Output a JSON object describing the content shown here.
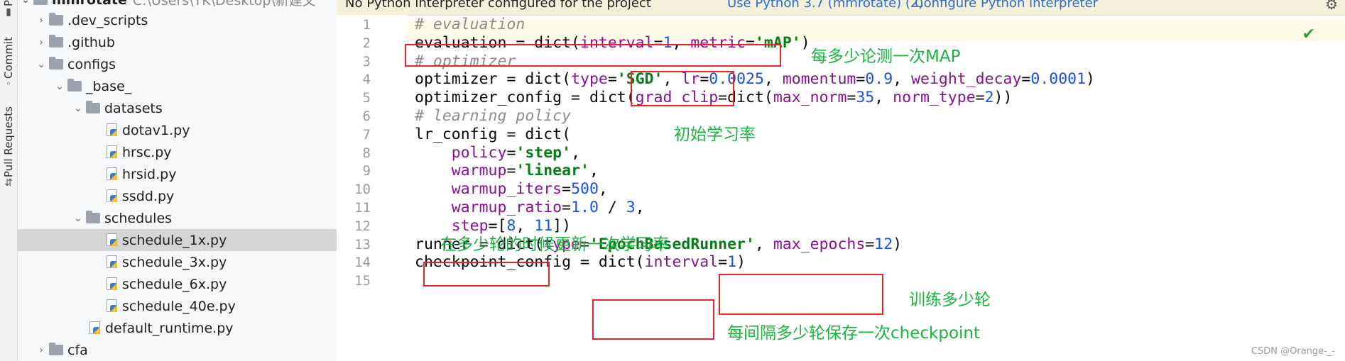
{
  "side_tabs": {
    "project_partial": "P",
    "commit": "Commit",
    "pull_requests": "Pull Requests"
  },
  "project_tree": {
    "root_label": "mmrotate",
    "root_path": "C:\\Users\\YK\\Desktop\\新建文",
    "items": [
      {
        "label": ".dev_scripts",
        "kind": "folder",
        "expanded": false
      },
      {
        "label": ".github",
        "kind": "folder",
        "expanded": false
      },
      {
        "label": "configs",
        "kind": "folder",
        "expanded": true
      },
      {
        "label": "_base_",
        "kind": "folder",
        "expanded": true
      },
      {
        "label": "datasets",
        "kind": "folder",
        "expanded": true
      },
      {
        "label": "dotav1.py",
        "kind": "file"
      },
      {
        "label": "hrsc.py",
        "kind": "file"
      },
      {
        "label": "hrsid.py",
        "kind": "file"
      },
      {
        "label": "ssdd.py",
        "kind": "file"
      },
      {
        "label": "schedules",
        "kind": "folder",
        "expanded": true
      },
      {
        "label": "schedule_1x.py",
        "kind": "file",
        "selected": true
      },
      {
        "label": "schedule_3x.py",
        "kind": "file"
      },
      {
        "label": "schedule_6x.py",
        "kind": "file"
      },
      {
        "label": "schedule_40e.py",
        "kind": "file"
      },
      {
        "label": "default_runtime.py",
        "kind": "file"
      },
      {
        "label": "cfa",
        "kind": "folder",
        "expanded": false
      }
    ]
  },
  "banner": {
    "message": "No Python interpreter configured for the project",
    "use_python_link": "Use Python 3.7 (mmrotate) (2)",
    "configure_link": "Configure Python interpreter"
  },
  "editor": {
    "line_numbers": [
      "1",
      "2",
      "3",
      "4",
      "5",
      "6",
      "7",
      "8",
      "9",
      "10",
      "11",
      "12",
      "13",
      "14",
      "15"
    ],
    "lines": [
      [
        {
          "t": "cm",
          "v": "# evaluation"
        }
      ],
      [
        {
          "t": "",
          "v": "evaluation = dict("
        },
        {
          "t": "kw",
          "v": "interval"
        },
        {
          "t": "",
          "v": "="
        },
        {
          "t": "num",
          "v": "1"
        },
        {
          "t": "",
          "v": ", "
        },
        {
          "t": "kw",
          "v": "metric"
        },
        {
          "t": "",
          "v": "="
        },
        {
          "t": "str",
          "v": "'mAP'"
        },
        {
          "t": "",
          "v": ")"
        }
      ],
      [
        {
          "t": "cm",
          "v": "# optimizer"
        }
      ],
      [
        {
          "t": "",
          "v": "optimizer = dict("
        },
        {
          "t": "kw",
          "v": "type"
        },
        {
          "t": "",
          "v": "="
        },
        {
          "t": "str",
          "v": "'SGD'"
        },
        {
          "t": "",
          "v": ", "
        },
        {
          "t": "kw",
          "v": "lr"
        },
        {
          "t": "",
          "v": "="
        },
        {
          "t": "num",
          "v": "0.0025"
        },
        {
          "t": "",
          "v": ", "
        },
        {
          "t": "kw",
          "v": "momentum"
        },
        {
          "t": "",
          "v": "="
        },
        {
          "t": "num",
          "v": "0.9"
        },
        {
          "t": "",
          "v": ", "
        },
        {
          "t": "kw",
          "v": "weight_decay"
        },
        {
          "t": "",
          "v": "="
        },
        {
          "t": "num",
          "v": "0.0001"
        },
        {
          "t": "",
          "v": ")"
        }
      ],
      [
        {
          "t": "",
          "v": "optimizer_config = dict("
        },
        {
          "t": "kw",
          "v": "grad_clip"
        },
        {
          "t": "",
          "v": "=dict("
        },
        {
          "t": "kw",
          "v": "max_norm"
        },
        {
          "t": "",
          "v": "="
        },
        {
          "t": "num",
          "v": "35"
        },
        {
          "t": "",
          "v": ", "
        },
        {
          "t": "kw",
          "v": "norm_type"
        },
        {
          "t": "",
          "v": "="
        },
        {
          "t": "num",
          "v": "2"
        },
        {
          "t": "",
          "v": "))"
        }
      ],
      [
        {
          "t": "cm",
          "v": "# learning policy"
        }
      ],
      [
        {
          "t": "",
          "v": "lr_config = dict("
        }
      ],
      [
        {
          "t": "",
          "v": "    "
        },
        {
          "t": "kw",
          "v": "policy"
        },
        {
          "t": "",
          "v": "="
        },
        {
          "t": "str",
          "v": "'step'"
        },
        {
          "t": "",
          "v": ","
        }
      ],
      [
        {
          "t": "",
          "v": "    "
        },
        {
          "t": "kw",
          "v": "warmup"
        },
        {
          "t": "",
          "v": "="
        },
        {
          "t": "str",
          "v": "'linear'"
        },
        {
          "t": "",
          "v": ","
        }
      ],
      [
        {
          "t": "",
          "v": "    "
        },
        {
          "t": "kw",
          "v": "warmup_iters"
        },
        {
          "t": "",
          "v": "="
        },
        {
          "t": "num",
          "v": "500"
        },
        {
          "t": "",
          "v": ","
        }
      ],
      [
        {
          "t": "",
          "v": "    "
        },
        {
          "t": "kw",
          "v": "warmup_ratio"
        },
        {
          "t": "",
          "v": "="
        },
        {
          "t": "num",
          "v": "1.0"
        },
        {
          "t": "",
          "v": " / "
        },
        {
          "t": "num",
          "v": "3"
        },
        {
          "t": "",
          "v": ","
        }
      ],
      [
        {
          "t": "",
          "v": "    "
        },
        {
          "t": "kw",
          "v": "step"
        },
        {
          "t": "",
          "v": "=["
        },
        {
          "t": "num",
          "v": "8"
        },
        {
          "t": "",
          "v": ", "
        },
        {
          "t": "num",
          "v": "11"
        },
        {
          "t": "",
          "v": "])"
        }
      ],
      [
        {
          "t": "",
          "v": "runner = dict("
        },
        {
          "t": "kw",
          "v": "type"
        },
        {
          "t": "",
          "v": "="
        },
        {
          "t": "str",
          "v": "'EpochBasedRunner'"
        },
        {
          "t": "",
          "v": ", "
        },
        {
          "t": "kw",
          "v": "max_epochs"
        },
        {
          "t": "",
          "v": "="
        },
        {
          "t": "num",
          "v": "12"
        },
        {
          "t": "",
          "v": ")"
        }
      ],
      [
        {
          "t": "",
          "v": "checkpoint_config = dict("
        },
        {
          "t": "kw",
          "v": "interval"
        },
        {
          "t": "",
          "v": "="
        },
        {
          "t": "num",
          "v": "1"
        },
        {
          "t": "",
          "v": ")"
        }
      ],
      [
        {
          "t": "",
          "v": ""
        }
      ]
    ]
  },
  "annotations": {
    "eval_interval": "每多少论测一次MAP",
    "initial_lr": "初始学习率",
    "lr_step": "在多少轮的时候更新一次学习率",
    "max_epochs": "训练多少轮",
    "checkpoint_interval": "每间隔多少轮保存一次checkpoint"
  },
  "watermark": "CSDN @Orange-_-",
  "colors": {
    "annotation_green": "#1ab33f",
    "highlight_red": "#e8242a",
    "keyword_purple": "#871094",
    "number_blue": "#1750eb",
    "string_green": "#067d17",
    "comment_gray": "#8c8c8c"
  }
}
